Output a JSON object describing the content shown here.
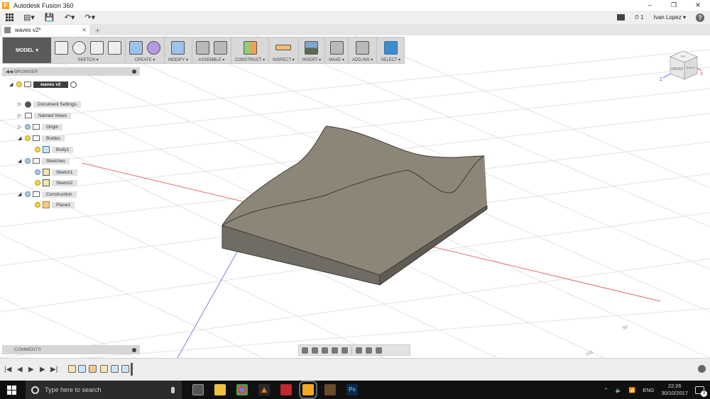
{
  "window": {
    "app_icon_letter": "F",
    "title": "Autodesk Fusion 360",
    "minimize": "–",
    "maximize": "❐",
    "close": "✕"
  },
  "quick_access": {
    "file_glyph": "▤▾",
    "save_glyph": "💾",
    "undo_glyph": "↶▾",
    "redo_glyph": "↷▾",
    "job_count": "1",
    "user_name": "Ivan Lopez ▾",
    "help_glyph": "?▾"
  },
  "document_tab": {
    "name": "waves v2*",
    "close": "✕",
    "new_tab": "+"
  },
  "ribbon": {
    "workspace": "MODEL",
    "workspace_caret": "▾",
    "groups": [
      {
        "label": "SKETCH ▾"
      },
      {
        "label": "CREATE ▾"
      },
      {
        "label": "MODIFY ▾"
      },
      {
        "label": "ASSEMBLE ▾"
      },
      {
        "label": "CONSTRUCT ▾"
      },
      {
        "label": "INSPECT ▾"
      },
      {
        "label": "INSERT ▾"
      },
      {
        "label": "MAKE ▾"
      },
      {
        "label": "ADD-INS ▾"
      },
      {
        "label": "SELECT ▾"
      }
    ]
  },
  "browser": {
    "header": "BROWSER",
    "root": "waves v2",
    "items": {
      "document_settings": "Document Settings",
      "named_views": "Named Views",
      "origin": "Origin",
      "bodies": "Bodies",
      "body1": "Body1",
      "sketches": "Sketches",
      "sketch1": "Sketch1",
      "sketch2": "Sketch2",
      "construction": "Construction",
      "plane1": "Plane1"
    }
  },
  "comments": {
    "header": "COMMENTS"
  },
  "viewcube": {
    "front": "FRONT",
    "right": "RIGHT",
    "top": "TOP",
    "axis_z": "Z",
    "axis_x": "X"
  },
  "grid_ticks": [
    "50",
    "100"
  ],
  "timeline": {
    "first": "|◀",
    "prev": "◀",
    "play": "▶",
    "next": "▶",
    "last": "▶|"
  },
  "taskbar": {
    "search_placeholder": "Type here to search",
    "language": "ENG",
    "time": "22:26",
    "date": "30/10/2017",
    "notification_count": "3"
  },
  "colors": {
    "ribbon_bg": "#d8d8d8",
    "model_body_top": "#8c8679",
    "model_body_side": "#6e6a60",
    "x_axis": "#e07070",
    "y_axis": "#8080e0",
    "select_accent": "#3c8ccc"
  }
}
